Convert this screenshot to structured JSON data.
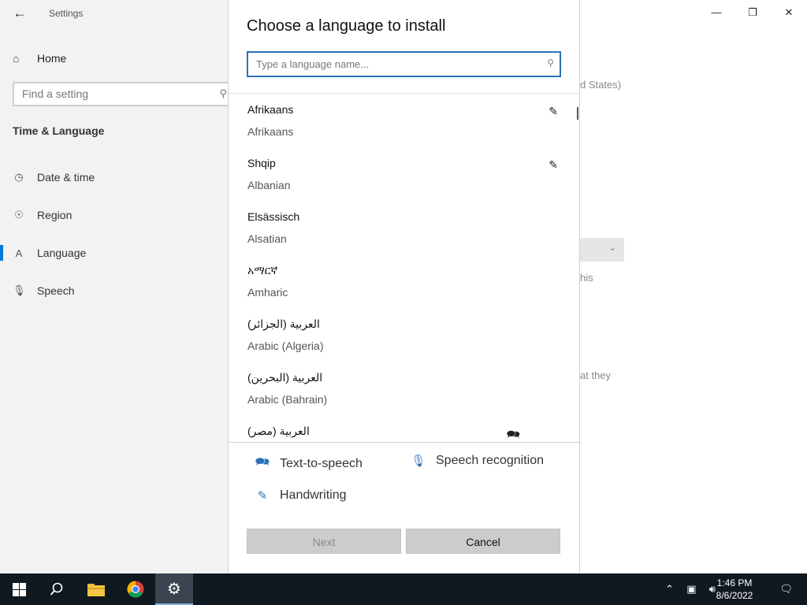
{
  "settings": {
    "app_title": "Settings",
    "home_label": "Home",
    "find_placeholder": "Find a setting",
    "section_title": "Time & Language",
    "nav": [
      {
        "label": "Date & time",
        "icon": "calendar-clock-icon"
      },
      {
        "label": "Region",
        "icon": "globe-icon"
      },
      {
        "label": "Language",
        "icon": "language-icon"
      },
      {
        "label": "Speech",
        "icon": "microphone-icon"
      }
    ],
    "bg_fragments": [
      "d States)",
      "his",
      "at they"
    ]
  },
  "dialog": {
    "title": "Choose a language to install",
    "search_placeholder": "Type a language name...",
    "languages": [
      {
        "native": "Afrikaans",
        "english": "Afrikaans",
        "feature_icon": "handwriting-icon"
      },
      {
        "native": "Shqip",
        "english": "Albanian",
        "feature_icon": "handwriting-icon"
      },
      {
        "native": "Elsässisch",
        "english": "Alsatian",
        "feature_icon": ""
      },
      {
        "native": "አማርኛ",
        "english": "Amharic",
        "feature_icon": ""
      },
      {
        "native": "العربية (الجزائر)",
        "english": "Arabic (Algeria)",
        "feature_icon": ""
      },
      {
        "native": "العربية (البحرين)",
        "english": "Arabic (Bahrain)",
        "feature_icon": ""
      },
      {
        "native": "العربية (مصر)",
        "english": "",
        "feature_icon": "text-to-speech-icon"
      }
    ],
    "legend": {
      "tts": "Text-to-speech",
      "speech": "Speech recognition",
      "handwriting": "Handwriting"
    },
    "next_label": "Next",
    "cancel_label": "Cancel"
  },
  "taskbar": {
    "time": "1:46 PM",
    "date": "8/6/2022"
  },
  "colors": {
    "accent": "#0078d7",
    "taskbar": "#101820",
    "button_bg": "#cccccc"
  }
}
